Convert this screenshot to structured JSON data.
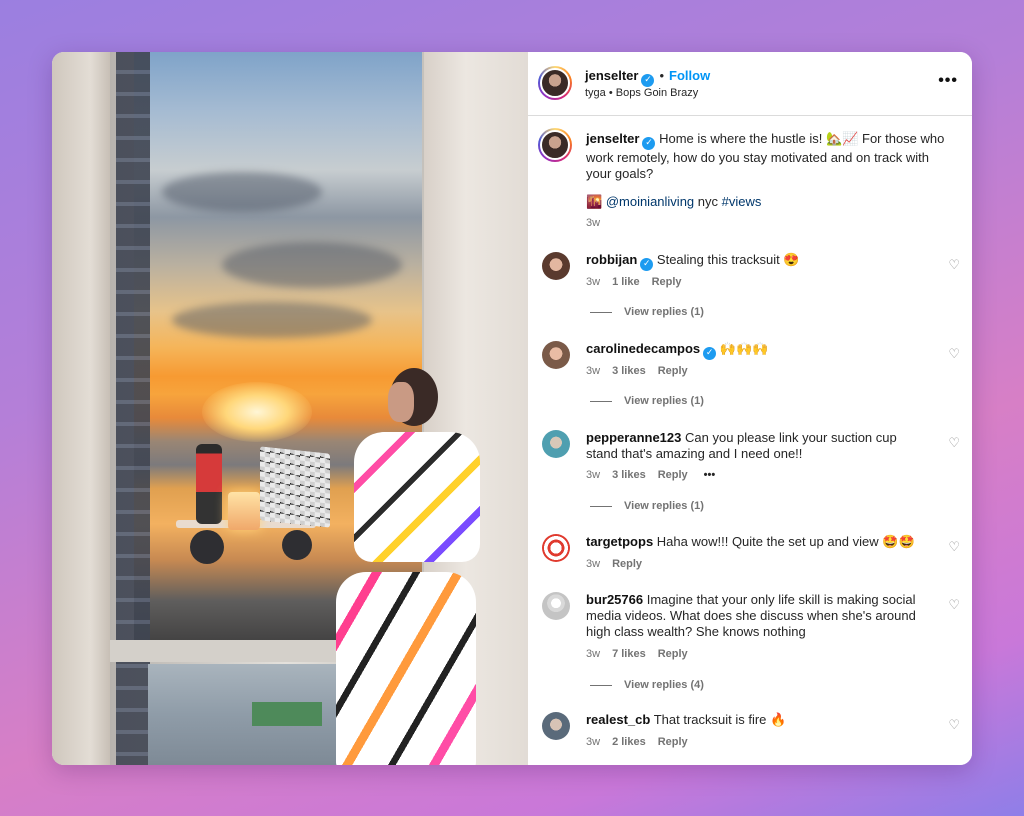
{
  "colors": {
    "accent": "#0095f6",
    "verified": "#1d9bf0",
    "muted": "#737373"
  },
  "post": {
    "author": "jenselter",
    "follow_label": "Follow",
    "separator": "•",
    "audio": "tyga • Bops Goin Brazy",
    "more_icon": "more-horizontal-icon",
    "caption_text": "Home is where the hustle is! 🏡📈 For those who work remotely, how do you stay motivated and on track with your goals?",
    "caption_emoji": "🌇",
    "caption_mention": "@moinianliving",
    "caption_tail": "nyc",
    "caption_hashtag": "#views",
    "caption_time": "3w"
  },
  "comments": [
    {
      "user": "robbijan",
      "verified": true,
      "text": "Stealing this tracksuit 😍",
      "time": "3w",
      "likes": "1 like",
      "reply": "Reply",
      "view_replies": "View replies (1)"
    },
    {
      "user": "carolinedecampos",
      "verified": true,
      "text": "🙌🙌🙌",
      "time": "3w",
      "likes": "3 likes",
      "reply": "Reply",
      "view_replies": "View replies (1)"
    },
    {
      "user": "pepperanne123",
      "verified": false,
      "text": "Can you please link your suction cup stand that's amazing and I need one!!",
      "time": "3w",
      "likes": "3 likes",
      "reply": "Reply",
      "extra": "•••",
      "view_replies": "View replies (1)"
    },
    {
      "user": "targetpops",
      "verified": false,
      "text": "Haha wow!!! Quite the set up and view 🤩🤩",
      "time": "3w",
      "reply": "Reply"
    },
    {
      "user": "bur25766",
      "verified": false,
      "text": "Imagine that your only life skill is making social media videos. What does she discuss when she's around high class wealth? She knows nothing",
      "time": "3w",
      "likes": "7 likes",
      "reply": "Reply",
      "view_replies": "View replies (4)"
    },
    {
      "user": "realest_cb",
      "verified": false,
      "text": "That tracksuit is fire 🔥",
      "time": "3w",
      "likes": "2 likes",
      "reply": "Reply"
    }
  ]
}
